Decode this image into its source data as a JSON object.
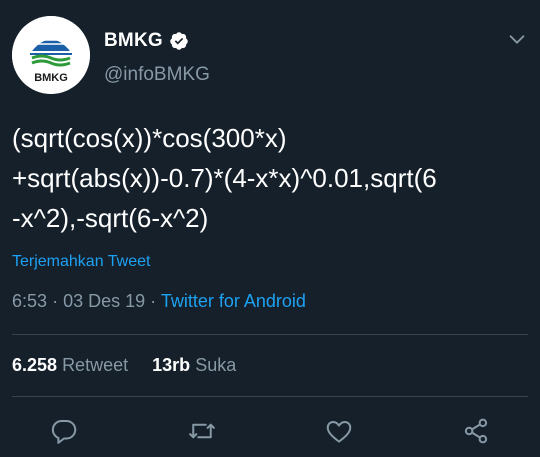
{
  "user": {
    "name": "BMKG",
    "handle": "@infoBMKG",
    "avatar_text": "BMKG"
  },
  "tweet": {
    "text": "(sqrt(cos(x))*cos(300*x)\n+sqrt(abs(x))-0.7)*(4-x*x)^0.01,sqrt(6\n-x^2),-sqrt(6-x^2)",
    "translate_link": "Terjemahkan Tweet",
    "time": "6:53",
    "date": "03 Des 19",
    "separator": "·",
    "source": "Twitter for Android"
  },
  "stats": {
    "retweets_count": "6.258",
    "retweets_label": "Retweet",
    "likes_count": "13rb",
    "likes_label": "Suka"
  },
  "icons": {
    "verified": "verified-badge-icon",
    "menu": "chevron-down-icon",
    "reply": "reply-icon",
    "retweet": "retweet-icon",
    "like": "heart-icon",
    "share": "share-icon"
  },
  "colors": {
    "background": "#15202b",
    "accent": "#1da1f2",
    "secondary_text": "#8899a6",
    "divider": "#38444d"
  }
}
